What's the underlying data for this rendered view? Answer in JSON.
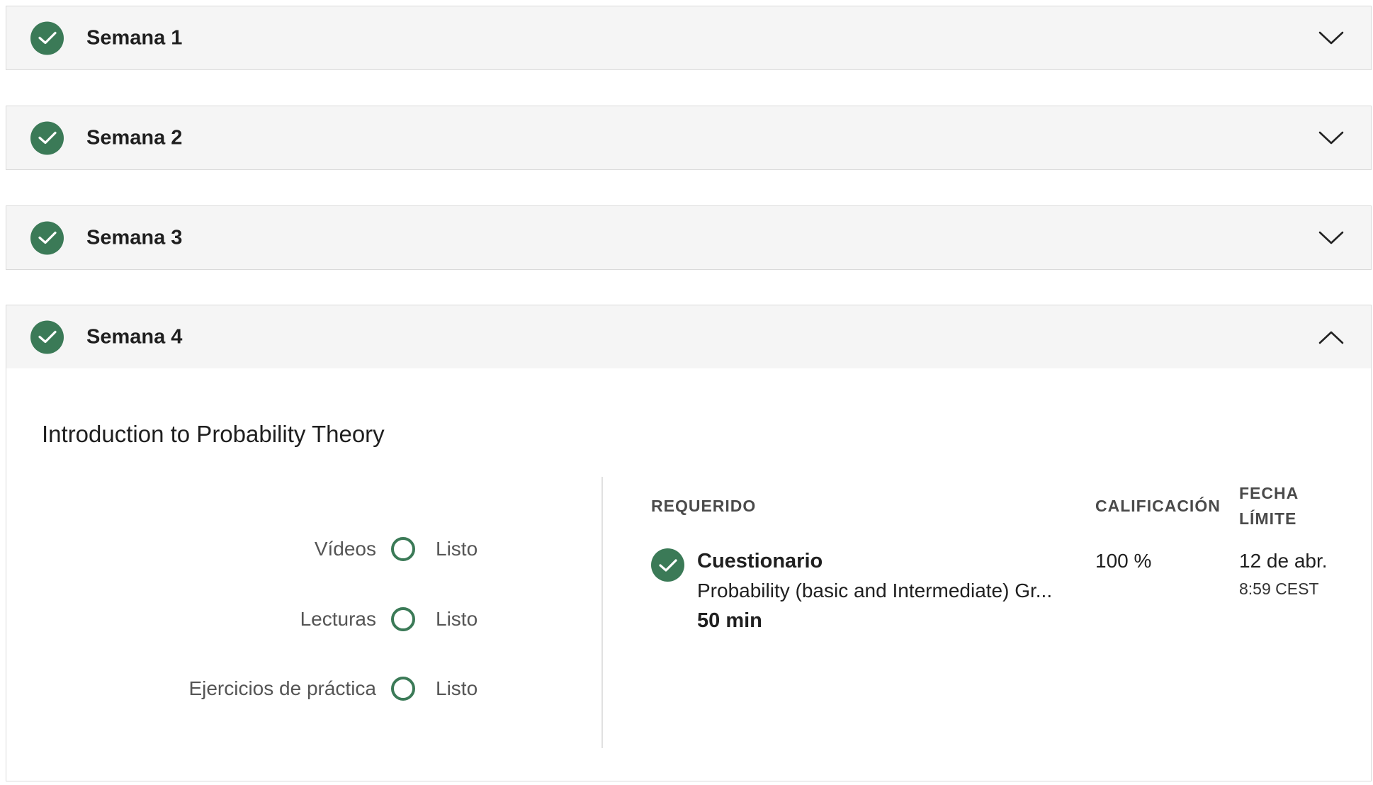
{
  "weeks": [
    {
      "title": "Semana 1",
      "state": "collapsed"
    },
    {
      "title": "Semana 2",
      "state": "collapsed"
    },
    {
      "title": "Semana 3",
      "state": "collapsed"
    },
    {
      "title": "Semana 4",
      "state": "expanded"
    }
  ],
  "module": {
    "title": "Introduction to Probability Theory",
    "progress": [
      {
        "label": "Vídeos",
        "status": "Listo"
      },
      {
        "label": "Lecturas",
        "status": "Listo"
      },
      {
        "label": "Ejercicios de práctica",
        "status": "Listo"
      }
    ],
    "columns": {
      "required": "REQUERIDO",
      "grade": "CALIFICACIÓN",
      "due_line1": "FECHA",
      "due_line2": "LÍMITE"
    },
    "items": [
      {
        "type": "Cuestionario",
        "name": "Probability (basic and Intermediate) Gr...",
        "duration": "50 min",
        "grade": "100 %",
        "due_date": "12 de abr.",
        "due_time": "8:59 CEST"
      }
    ]
  },
  "colors": {
    "accent": "#3b7a57",
    "header_bg": "#f5f5f5",
    "border": "#dadada"
  },
  "icons": {
    "completed": "check-circle-icon",
    "collapsed": "chevron-down-icon",
    "expanded": "chevron-up-icon",
    "progress": "empty-circle-icon"
  }
}
